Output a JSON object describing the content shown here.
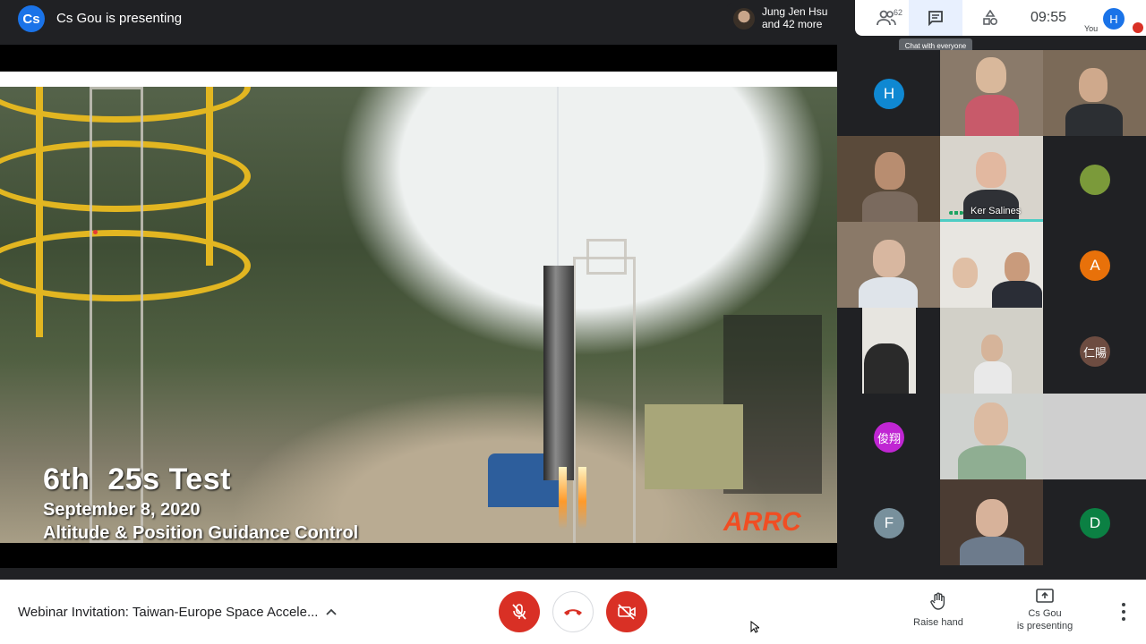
{
  "header": {
    "presenter_initials": "Cs",
    "presenting_text": "Cs Gou is presenting",
    "attendee_name": "Jung Jen Hsu",
    "attendee_more": "and 42 more",
    "people_count": "62",
    "clock": "09:55",
    "self_initial": "H",
    "self_label": "You",
    "chat_tooltip": "Chat with everyone",
    "icons": [
      "people-icon",
      "chat-icon",
      "activities-icon",
      "mic-off-icon"
    ]
  },
  "slide": {
    "title": "6th  25s Test",
    "date": "September 8, 2020",
    "subtitle": "Altitude & Position Guidance Control",
    "logo": "ARRC"
  },
  "participants": [
    {
      "type": "avatar",
      "initial": "H",
      "color": "#0f88d2"
    },
    {
      "type": "video",
      "label": ""
    },
    {
      "type": "video",
      "label": ""
    },
    {
      "type": "video",
      "label": ""
    },
    {
      "type": "video",
      "label": "Ker Salines"
    },
    {
      "type": "avatar",
      "initial": "",
      "color": "#7b9a3a"
    },
    {
      "type": "video",
      "label": ""
    },
    {
      "type": "video",
      "label": ""
    },
    {
      "type": "avatar",
      "initial": "A",
      "color": "#e8710a"
    },
    {
      "type": "video",
      "label": ""
    },
    {
      "type": "video",
      "label": ""
    },
    {
      "type": "avatar",
      "initial": "仁陽",
      "color": "#6d4c41"
    },
    {
      "type": "avatar",
      "initial": "俊翔",
      "color": "#c026d3"
    },
    {
      "type": "video",
      "label": ""
    },
    {
      "type": "video",
      "label": ""
    },
    {
      "type": "avatar",
      "initial": "F",
      "color": "#78909c"
    },
    {
      "type": "video",
      "label": ""
    },
    {
      "type": "avatar",
      "initial": "D",
      "color": "#0b8043"
    }
  ],
  "footer": {
    "meeting_title": "Webinar Invitation: Taiwan-Europe Space Accele...",
    "raise_hand": "Raise hand",
    "present_line1": "Cs Gou",
    "present_line2": "is presenting"
  },
  "colors": {
    "danger": "#d93025",
    "accent": "#1a73e8"
  }
}
